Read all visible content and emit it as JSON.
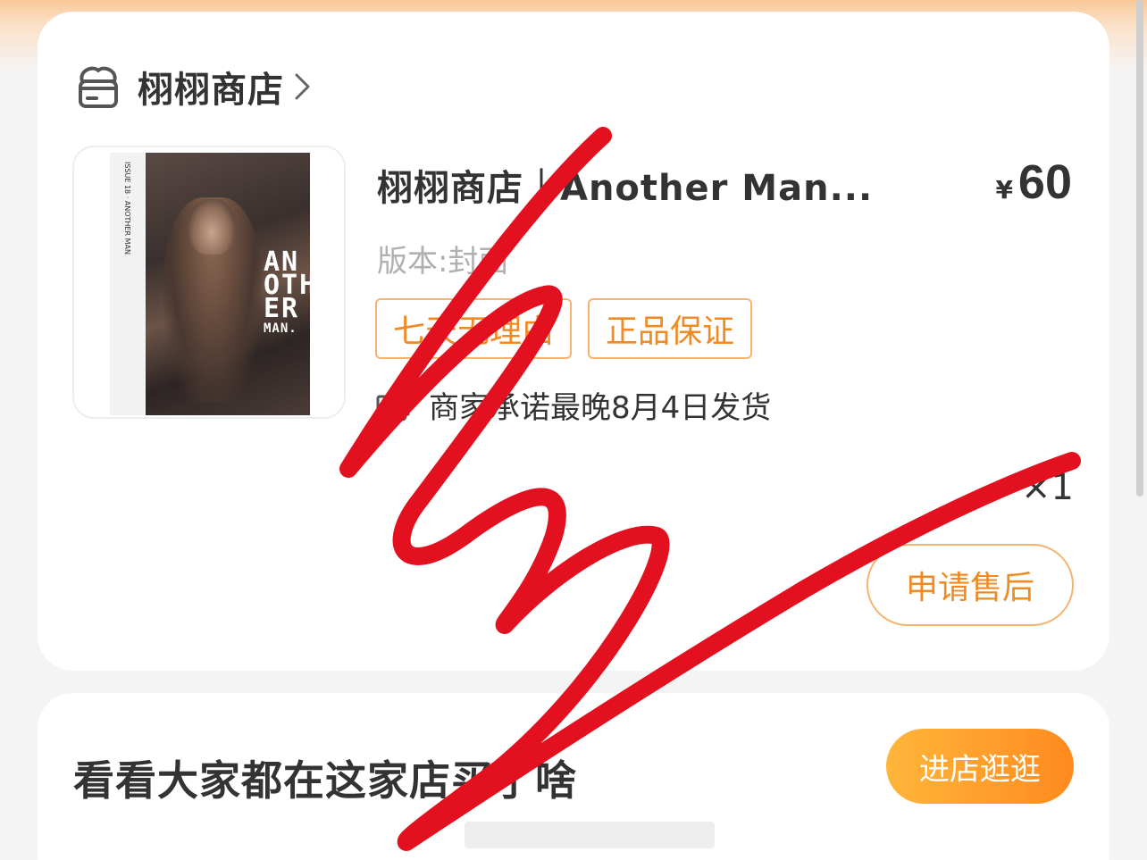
{
  "shop": {
    "name": "栩栩商店",
    "icon": "shop-icon",
    "chevron_icon": "chevron-right-icon"
  },
  "product": {
    "title": "栩栩商店｜Another Man...",
    "price_symbol": "¥",
    "price": "60",
    "variant": "版本:封面",
    "tags": [
      "七天无理由",
      "正品保证"
    ],
    "shipping_note": "商家承诺最晚8月4日发货",
    "shipping_icon": "truck-icon",
    "quantity": "×1",
    "after_sales_label": "申请售后",
    "cover": {
      "title_lines": [
        "AN",
        "OTH",
        "ER",
        "MAN."
      ],
      "spine_text": "ISSUE 18 · ANOTHER MAN"
    }
  },
  "recommend": {
    "title": "看看大家都在这家店买了啥",
    "visit_button": "进店逛逛"
  },
  "colors": {
    "accent_orange": "#f08a24",
    "tag_border": "#f6b26e",
    "button_gradient_start": "#ffb63a",
    "button_gradient_end": "#ff8a1e",
    "scribble_red": "#e3101f"
  }
}
